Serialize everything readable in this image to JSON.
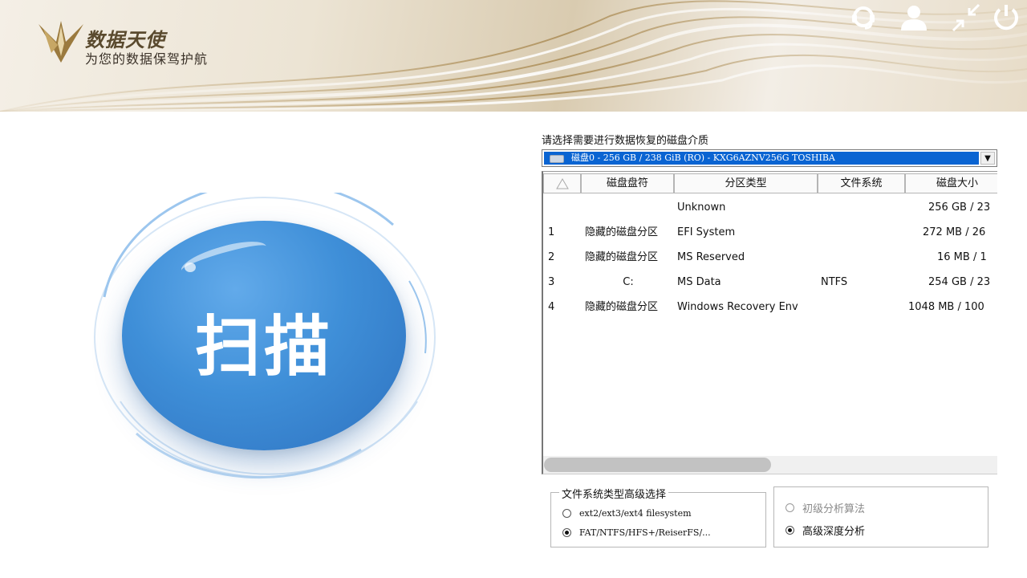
{
  "header": {
    "brand_title": "数据天使",
    "brand_subtitle": "为您的数据保驾护航",
    "icons": [
      "support-headset-icon",
      "user-icon",
      "minimize-arrows-icon",
      "power-icon"
    ]
  },
  "scan": {
    "label": "扫描"
  },
  "disk": {
    "caption": "请选择需要进行数据恢复的磁盘介质",
    "selected": "磁盘0 - 256 GB / 238 GiB (RO) - KXG6AZNV256G TOSHIBA",
    "dropdown_arrow": "▼"
  },
  "partition_table": {
    "headers": [
      "",
      "磁盘盘符",
      "分区类型",
      "文件系统",
      "磁盘大小"
    ],
    "rows": [
      {
        "num": "",
        "letter": "",
        "type": "Unknown",
        "fs": "",
        "size": "256 GB / 23"
      },
      {
        "num": "1",
        "letter": "隐藏的磁盘分区",
        "type": "EFI System",
        "fs": "",
        "size": "272 MB / 26"
      },
      {
        "num": "2",
        "letter": "隐藏的磁盘分区",
        "type": "MS Reserved",
        "fs": "",
        "size": "16 MB / 1"
      },
      {
        "num": "3",
        "letter": "C:",
        "type": "MS Data",
        "fs": "NTFS",
        "size": "254 GB / 23"
      },
      {
        "num": "4",
        "letter": "隐藏的磁盘分区",
        "type": "Windows Recovery Env",
        "fs": "",
        "size": "1048 MB / 100"
      }
    ]
  },
  "fs_group": {
    "legend": "文件系统类型高级选择",
    "options": [
      {
        "label": "ext2/ext3/ext4 filesystem",
        "selected": false
      },
      {
        "label": "FAT/NTFS/HFS+/ReiserFS/...",
        "selected": true
      }
    ]
  },
  "analysis_group": {
    "options": [
      {
        "label": "初级分析算法",
        "selected": false,
        "disabled": true
      },
      {
        "label": "高级深度分析",
        "selected": true,
        "disabled": false
      }
    ]
  },
  "colors": {
    "scan_blue": "#3f8fd8",
    "selection_blue": "#0a64d2",
    "header_gold": "#d9cbb0"
  }
}
